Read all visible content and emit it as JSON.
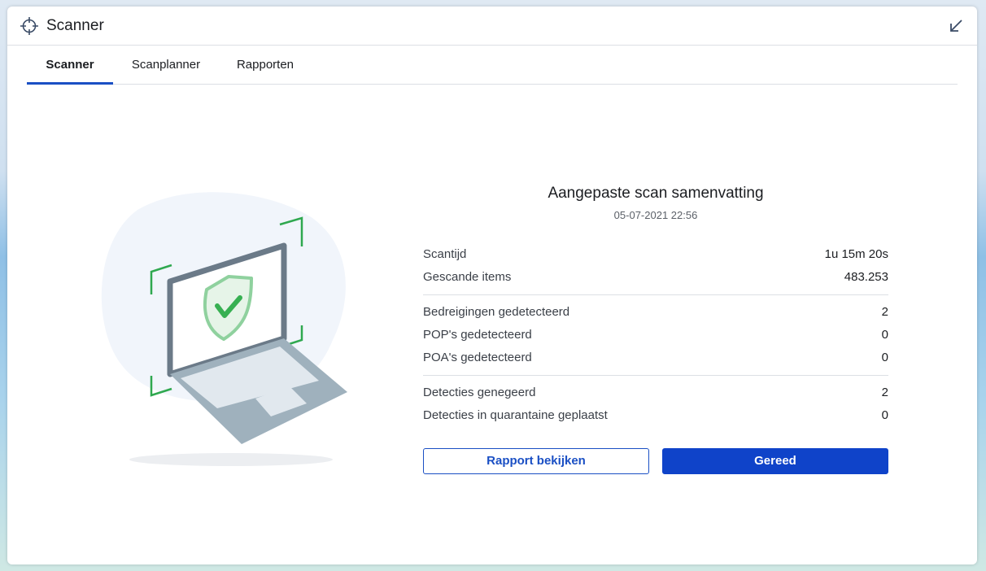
{
  "window": {
    "title": "Scanner",
    "app_icon": "crosshair-icon",
    "minimize_icon": "arrow-down-left-icon"
  },
  "tabs": [
    {
      "label": "Scanner",
      "active": true
    },
    {
      "label": "Scanplanner",
      "active": false
    },
    {
      "label": "Rapporten",
      "active": false
    }
  ],
  "summary": {
    "title": "Aangepaste scan samenvatting",
    "date": "05-07-2021 22:56",
    "groups": [
      [
        {
          "label": "Scantijd",
          "value": "1u 15m 20s"
        },
        {
          "label": "Gescande items",
          "value": "483.253"
        }
      ],
      [
        {
          "label": "Bedreigingen gedetecteerd",
          "value": "2"
        },
        {
          "label": "POP's gedetecteerd",
          "value": "0"
        },
        {
          "label": "POA's gedetecteerd",
          "value": "0"
        }
      ],
      [
        {
          "label": "Detecties genegeerd",
          "value": "2"
        },
        {
          "label": "Detecties in quarantaine geplaatst",
          "value": "0"
        }
      ]
    ]
  },
  "buttons": {
    "report_label": "Rapport bekijken",
    "done_label": "Gereed"
  },
  "colors": {
    "accent": "#1a4fc4",
    "primary_button": "#0f43c9",
    "shield_green": "#3cb85a"
  },
  "illustration": {
    "icon": "laptop-shield-check-icon"
  }
}
